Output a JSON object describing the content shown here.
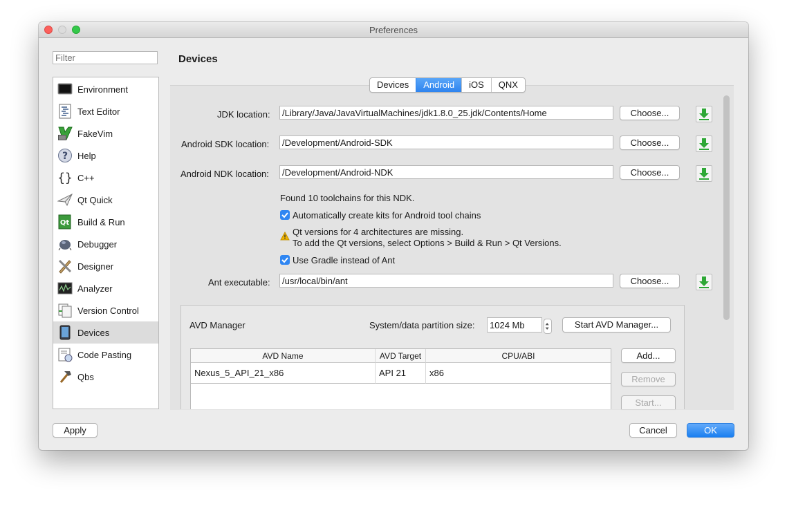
{
  "window": {
    "title": "Preferences",
    "traffic_light_colors": [
      "#fc605c",
      "#dcdcdc",
      "#34c84a"
    ]
  },
  "sidebar": {
    "filter_placeholder": "Filter",
    "items": [
      {
        "label": "Environment",
        "icon": "monitor-icon"
      },
      {
        "label": "Text Editor",
        "icon": "text-document-icon"
      },
      {
        "label": "FakeVim",
        "icon": "fakevim-icon"
      },
      {
        "label": "Help",
        "icon": "help-icon"
      },
      {
        "label": "C++",
        "icon": "braces-icon"
      },
      {
        "label": "Qt Quick",
        "icon": "paper-plane-icon"
      },
      {
        "label": "Build & Run",
        "icon": "build-run-icon"
      },
      {
        "label": "Debugger",
        "icon": "bug-icon"
      },
      {
        "label": "Designer",
        "icon": "designer-tools-icon"
      },
      {
        "label": "Analyzer",
        "icon": "oscilloscope-icon"
      },
      {
        "label": "Version Control",
        "icon": "version-control-icon"
      },
      {
        "label": "Devices",
        "icon": "device-icon",
        "selected": true
      },
      {
        "label": "Code Pasting",
        "icon": "code-pasting-icon"
      },
      {
        "label": "Qbs",
        "icon": "hammer-icon"
      }
    ]
  },
  "page_title": "Devices",
  "tabs": [
    {
      "label": "Devices",
      "active": false
    },
    {
      "label": "Android",
      "active": true
    },
    {
      "label": "iOS",
      "active": false
    },
    {
      "label": "QNX",
      "active": false
    }
  ],
  "android": {
    "jdk": {
      "label": "JDK location:",
      "value": "/Library/Java/JavaVirtualMachines/jdk1.8.0_25.jdk/Contents/Home",
      "button": "Choose..."
    },
    "sdk": {
      "label": "Android SDK location:",
      "value": "/Development/Android-SDK",
      "button": "Choose..."
    },
    "ndk": {
      "label": "Android NDK location:",
      "value": "/Development/Android-NDK",
      "button": "Choose..."
    },
    "toolchains_text": "Found 10 toolchains for this NDK.",
    "auto_kits": {
      "label": "Automatically create kits for Android tool chains",
      "checked": true
    },
    "warning_line1": "Qt versions for 4 architectures are missing.",
    "warning_line2": "To add the Qt versions, select Options > Build & Run > Qt Versions.",
    "gradle": {
      "label": "Use Gradle instead of Ant",
      "checked": true
    },
    "ant": {
      "label": "Ant executable:",
      "value": "/usr/local/bin/ant",
      "button": "Choose..."
    }
  },
  "avd": {
    "title": "AVD Manager",
    "partition_label": "System/data partition size:",
    "partition_value": "1024 Mb",
    "start_manager": "Start AVD Manager...",
    "columns": [
      "AVD Name",
      "AVD Target",
      "CPU/ABI"
    ],
    "rows": [
      {
        "name": "Nexus_5_API_21_x86",
        "target": "API 21",
        "abi": "x86"
      }
    ],
    "add": "Add...",
    "remove": "Remove",
    "start": "Start..."
  },
  "footer": {
    "apply": "Apply",
    "cancel": "Cancel",
    "ok": "OK"
  },
  "colors": {
    "accent": "#2e84ef",
    "download_green": "#2ea836",
    "warning": "#f0b400"
  }
}
